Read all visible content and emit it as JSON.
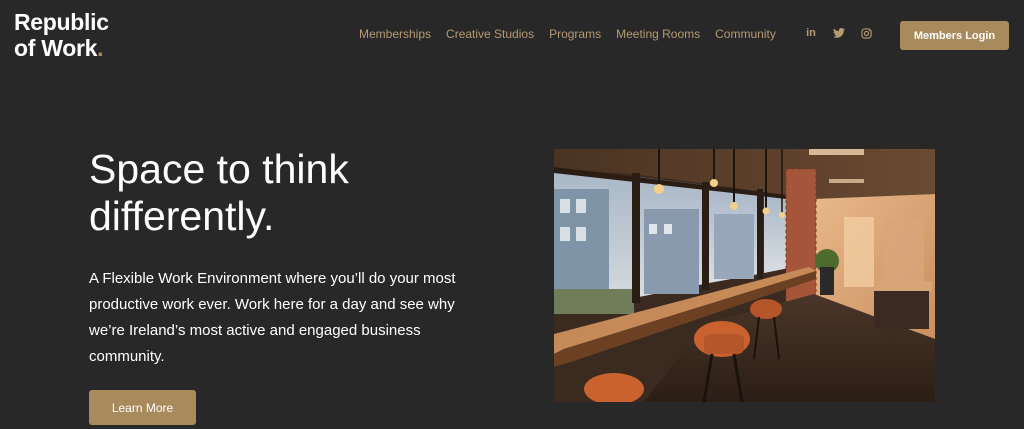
{
  "brand": {
    "line1": "Republic",
    "line2": "of Work",
    "dot": "."
  },
  "nav": {
    "items": [
      "Memberships",
      "Creative Studios",
      "Programs",
      "Meeting Rooms",
      "Community"
    ]
  },
  "social": {
    "linkedin": "in",
    "twitter_icon": "twitter-icon",
    "instagram_icon": "instagram-icon"
  },
  "header": {
    "login_label": "Members Login"
  },
  "hero": {
    "title_line1": "Space to think",
    "title_line2": "differently.",
    "body": "A Flexible Work Environment where you’ll do your most productive work ever. Work here for a day and see why we’re Ireland’s most active and engaged business community.",
    "cta_label": "Learn More"
  },
  "colors": {
    "background": "#282828",
    "accent": "#a88a5c",
    "nav_text": "#b59a72"
  }
}
